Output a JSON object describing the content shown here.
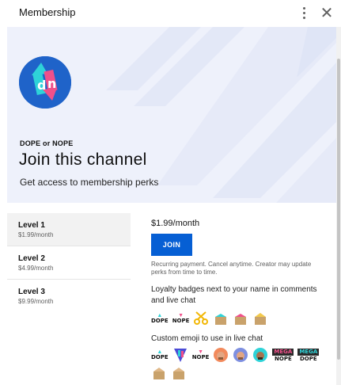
{
  "dialog": {
    "title": "Membership",
    "more_icon": "more-vert-icon",
    "close_icon": "close-icon",
    "close_glyph": "✕"
  },
  "hero": {
    "channel_name": "DOPE or NOPE",
    "heading": "Join this channel",
    "subheading": "Get access to membership perks",
    "avatar_icon": "channel-logo-dn-icon",
    "colors": {
      "background": "#eef1fb",
      "avatar": "#1f63c9"
    }
  },
  "levels": [
    {
      "name": "Level 1",
      "price": "$1.99/month",
      "selected": true
    },
    {
      "name": "Level 2",
      "price": "$4.99/month",
      "selected": false
    },
    {
      "name": "Level 3",
      "price": "$9.99/month",
      "selected": false
    }
  ],
  "detail": {
    "price": "$1.99/month",
    "join_label": "JOIN",
    "terms": "Recurring payment. Cancel anytime. Creator may update perks from time to time.",
    "perks": {
      "badges_label": "Loyalty badges next to your name in comments and live chat",
      "emoji_label": "Custom emoji to use in live chat"
    },
    "badge_texts": {
      "dope": "DOPE",
      "nope": "NOPE"
    },
    "emoji_texts": {
      "dope": "DOPE",
      "nope": "NOPE",
      "mega": "MEGA",
      "mega_nope": "NOPE",
      "mega_dope": "DOPE"
    },
    "colors": {
      "join_button": "#065fd4",
      "accent": "#065fd4"
    }
  }
}
